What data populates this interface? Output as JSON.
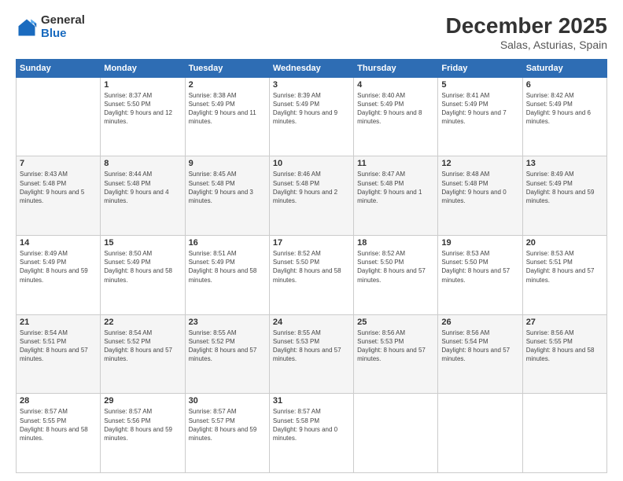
{
  "header": {
    "logo": {
      "line1": "General",
      "line2": "Blue"
    },
    "title": "December 2025",
    "subtitle": "Salas, Asturias, Spain"
  },
  "weekdays": [
    "Sunday",
    "Monday",
    "Tuesday",
    "Wednesday",
    "Thursday",
    "Friday",
    "Saturday"
  ],
  "weeks": [
    [
      {
        "day": "",
        "sunrise": "",
        "sunset": "",
        "daylight": ""
      },
      {
        "day": "1",
        "sunrise": "Sunrise: 8:37 AM",
        "sunset": "Sunset: 5:50 PM",
        "daylight": "Daylight: 9 hours and 12 minutes."
      },
      {
        "day": "2",
        "sunrise": "Sunrise: 8:38 AM",
        "sunset": "Sunset: 5:49 PM",
        "daylight": "Daylight: 9 hours and 11 minutes."
      },
      {
        "day": "3",
        "sunrise": "Sunrise: 8:39 AM",
        "sunset": "Sunset: 5:49 PM",
        "daylight": "Daylight: 9 hours and 9 minutes."
      },
      {
        "day": "4",
        "sunrise": "Sunrise: 8:40 AM",
        "sunset": "Sunset: 5:49 PM",
        "daylight": "Daylight: 9 hours and 8 minutes."
      },
      {
        "day": "5",
        "sunrise": "Sunrise: 8:41 AM",
        "sunset": "Sunset: 5:49 PM",
        "daylight": "Daylight: 9 hours and 7 minutes."
      },
      {
        "day": "6",
        "sunrise": "Sunrise: 8:42 AM",
        "sunset": "Sunset: 5:49 PM",
        "daylight": "Daylight: 9 hours and 6 minutes."
      }
    ],
    [
      {
        "day": "7",
        "sunrise": "Sunrise: 8:43 AM",
        "sunset": "Sunset: 5:48 PM",
        "daylight": "Daylight: 9 hours and 5 minutes."
      },
      {
        "day": "8",
        "sunrise": "Sunrise: 8:44 AM",
        "sunset": "Sunset: 5:48 PM",
        "daylight": "Daylight: 9 hours and 4 minutes."
      },
      {
        "day": "9",
        "sunrise": "Sunrise: 8:45 AM",
        "sunset": "Sunset: 5:48 PM",
        "daylight": "Daylight: 9 hours and 3 minutes."
      },
      {
        "day": "10",
        "sunrise": "Sunrise: 8:46 AM",
        "sunset": "Sunset: 5:48 PM",
        "daylight": "Daylight: 9 hours and 2 minutes."
      },
      {
        "day": "11",
        "sunrise": "Sunrise: 8:47 AM",
        "sunset": "Sunset: 5:48 PM",
        "daylight": "Daylight: 9 hours and 1 minute."
      },
      {
        "day": "12",
        "sunrise": "Sunrise: 8:48 AM",
        "sunset": "Sunset: 5:48 PM",
        "daylight": "Daylight: 9 hours and 0 minutes."
      },
      {
        "day": "13",
        "sunrise": "Sunrise: 8:49 AM",
        "sunset": "Sunset: 5:49 PM",
        "daylight": "Daylight: 8 hours and 59 minutes."
      }
    ],
    [
      {
        "day": "14",
        "sunrise": "Sunrise: 8:49 AM",
        "sunset": "Sunset: 5:49 PM",
        "daylight": "Daylight: 8 hours and 59 minutes."
      },
      {
        "day": "15",
        "sunrise": "Sunrise: 8:50 AM",
        "sunset": "Sunset: 5:49 PM",
        "daylight": "Daylight: 8 hours and 58 minutes."
      },
      {
        "day": "16",
        "sunrise": "Sunrise: 8:51 AM",
        "sunset": "Sunset: 5:49 PM",
        "daylight": "Daylight: 8 hours and 58 minutes."
      },
      {
        "day": "17",
        "sunrise": "Sunrise: 8:52 AM",
        "sunset": "Sunset: 5:50 PM",
        "daylight": "Daylight: 8 hours and 58 minutes."
      },
      {
        "day": "18",
        "sunrise": "Sunrise: 8:52 AM",
        "sunset": "Sunset: 5:50 PM",
        "daylight": "Daylight: 8 hours and 57 minutes."
      },
      {
        "day": "19",
        "sunrise": "Sunrise: 8:53 AM",
        "sunset": "Sunset: 5:50 PM",
        "daylight": "Daylight: 8 hours and 57 minutes."
      },
      {
        "day": "20",
        "sunrise": "Sunrise: 8:53 AM",
        "sunset": "Sunset: 5:51 PM",
        "daylight": "Daylight: 8 hours and 57 minutes."
      }
    ],
    [
      {
        "day": "21",
        "sunrise": "Sunrise: 8:54 AM",
        "sunset": "Sunset: 5:51 PM",
        "daylight": "Daylight: 8 hours and 57 minutes."
      },
      {
        "day": "22",
        "sunrise": "Sunrise: 8:54 AM",
        "sunset": "Sunset: 5:52 PM",
        "daylight": "Daylight: 8 hours and 57 minutes."
      },
      {
        "day": "23",
        "sunrise": "Sunrise: 8:55 AM",
        "sunset": "Sunset: 5:52 PM",
        "daylight": "Daylight: 8 hours and 57 minutes."
      },
      {
        "day": "24",
        "sunrise": "Sunrise: 8:55 AM",
        "sunset": "Sunset: 5:53 PM",
        "daylight": "Daylight: 8 hours and 57 minutes."
      },
      {
        "day": "25",
        "sunrise": "Sunrise: 8:56 AM",
        "sunset": "Sunset: 5:53 PM",
        "daylight": "Daylight: 8 hours and 57 minutes."
      },
      {
        "day": "26",
        "sunrise": "Sunrise: 8:56 AM",
        "sunset": "Sunset: 5:54 PM",
        "daylight": "Daylight: 8 hours and 57 minutes."
      },
      {
        "day": "27",
        "sunrise": "Sunrise: 8:56 AM",
        "sunset": "Sunset: 5:55 PM",
        "daylight": "Daylight: 8 hours and 58 minutes."
      }
    ],
    [
      {
        "day": "28",
        "sunrise": "Sunrise: 8:57 AM",
        "sunset": "Sunset: 5:55 PM",
        "daylight": "Daylight: 8 hours and 58 minutes."
      },
      {
        "day": "29",
        "sunrise": "Sunrise: 8:57 AM",
        "sunset": "Sunset: 5:56 PM",
        "daylight": "Daylight: 8 hours and 59 minutes."
      },
      {
        "day": "30",
        "sunrise": "Sunrise: 8:57 AM",
        "sunset": "Sunset: 5:57 PM",
        "daylight": "Daylight: 8 hours and 59 minutes."
      },
      {
        "day": "31",
        "sunrise": "Sunrise: 8:57 AM",
        "sunset": "Sunset: 5:58 PM",
        "daylight": "Daylight: 9 hours and 0 minutes."
      },
      {
        "day": "",
        "sunrise": "",
        "sunset": "",
        "daylight": ""
      },
      {
        "day": "",
        "sunrise": "",
        "sunset": "",
        "daylight": ""
      },
      {
        "day": "",
        "sunrise": "",
        "sunset": "",
        "daylight": ""
      }
    ]
  ]
}
